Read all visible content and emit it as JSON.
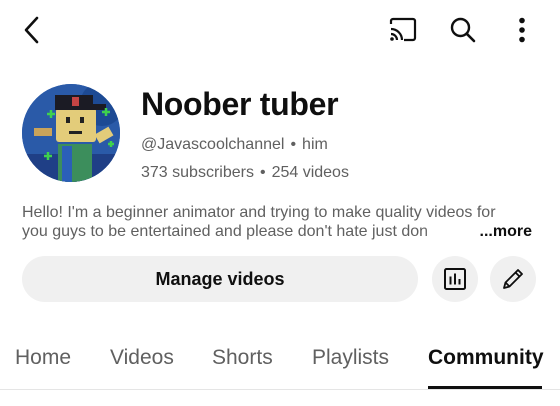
{
  "header": {
    "back_icon": "back-arrow-icon",
    "cast_icon": "cast-icon",
    "search_icon": "search-icon",
    "more_icon": "more-vert-icon"
  },
  "channel": {
    "name": "Noober tuber",
    "handle": "@Javascoolchannel",
    "pronouns": "him",
    "subscribers": "373 subscribers",
    "videos": "254 videos",
    "description_line1": "Hello! I'm a beginner animator and trying to make quality videos for",
    "description_line2": "you guys to be entertained and please don't hate just don",
    "more_label": "...more"
  },
  "actions": {
    "manage_videos_label": "Manage videos",
    "analytics_icon": "analytics-icon",
    "edit_icon": "pencil-icon"
  },
  "tabs": {
    "home": "Home",
    "videos": "Videos",
    "shorts": "Shorts",
    "playlists": "Playlists",
    "community": "Community",
    "active": "Community"
  },
  "colors": {
    "text_primary": "#0f0f0f",
    "text_secondary": "#606060",
    "button_bg": "#f0f0f0"
  }
}
